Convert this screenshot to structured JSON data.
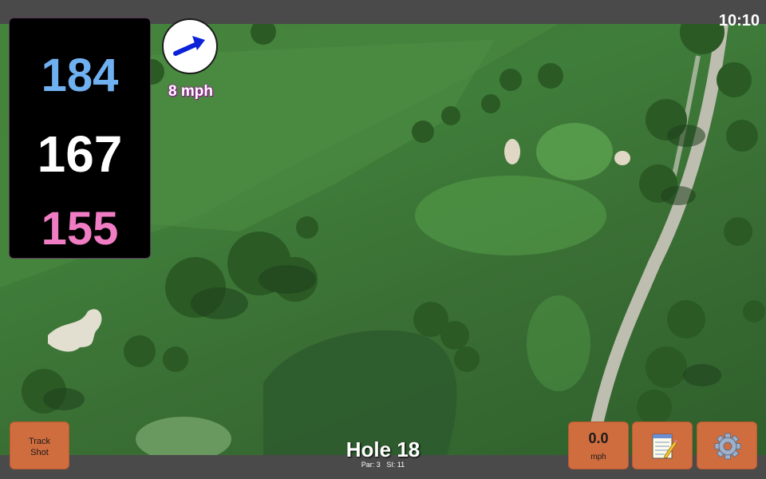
{
  "status": {
    "time": "10:10"
  },
  "distances": {
    "back": "184",
    "middle": "167",
    "front": "155"
  },
  "wind": {
    "speed": "8 mph",
    "icon": "wind-arrow-icon"
  },
  "hole": {
    "title": "Hole 18",
    "par": "Par: 3",
    "si": "SI: 11"
  },
  "buttons": {
    "track_shot": "Track\nShot",
    "speed_value": "0.0",
    "speed_unit": "mph",
    "notes_icon": "notepad-icon",
    "settings_icon": "gear-icon"
  },
  "colors": {
    "back": "#6fb0f0",
    "middle": "#ffffff",
    "front": "#f07cc4",
    "button": "#d06d3f"
  }
}
